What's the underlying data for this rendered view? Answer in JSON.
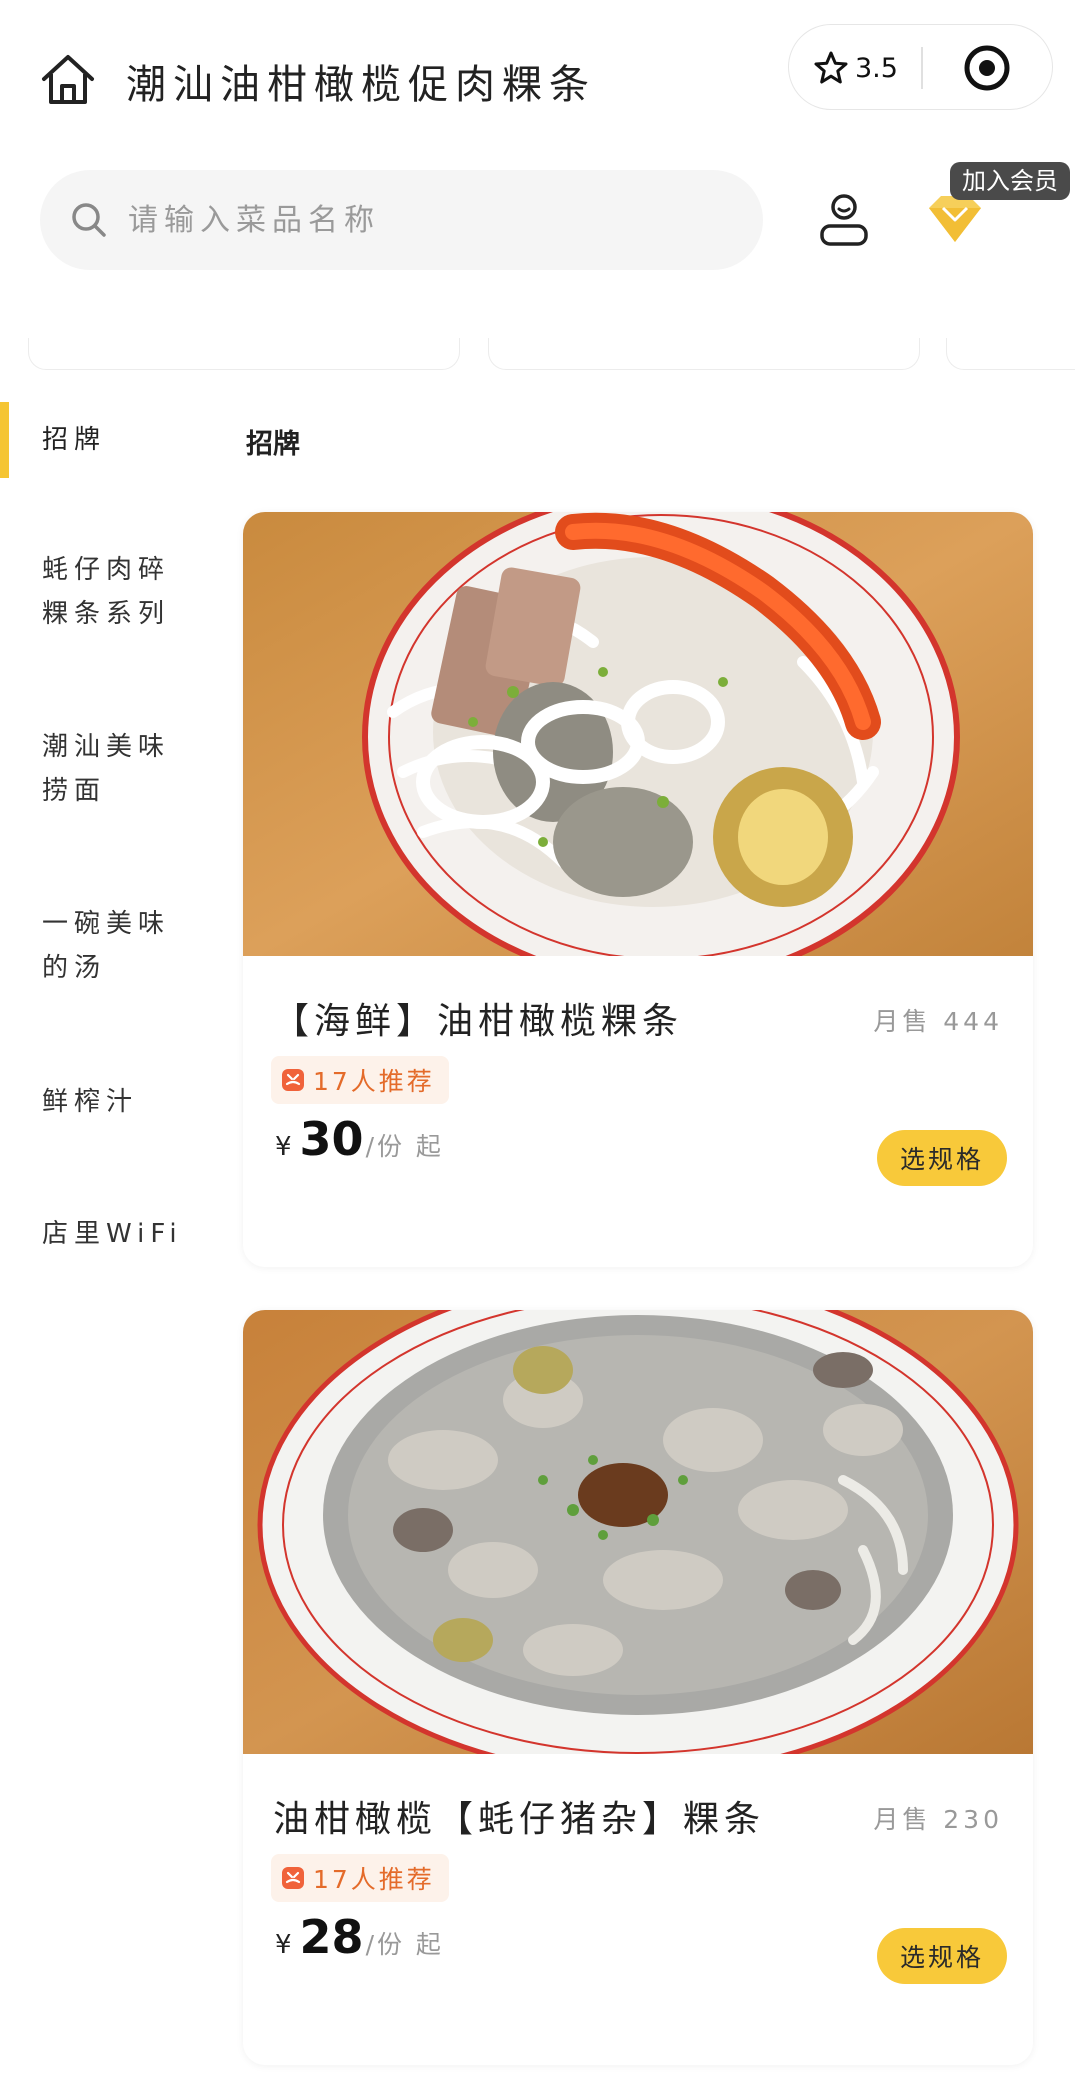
{
  "header": {
    "title": "潮汕油柑橄榄促肉粿条",
    "rating": "3.5",
    "search_placeholder": "请输入菜品名称",
    "vip_tip": "加入会员"
  },
  "sidebar": {
    "items": [
      {
        "label": "招牌",
        "active": true
      },
      {
        "label": "蚝仔肉碎粿条系列",
        "active": false
      },
      {
        "label": "潮汕美味捞面",
        "active": false
      },
      {
        "label": "一碗美味的汤",
        "active": false
      },
      {
        "label": "鲜榨汁",
        "active": false
      },
      {
        "label": "店里WiFi",
        "active": false
      }
    ]
  },
  "section": {
    "title": "招牌"
  },
  "products": [
    {
      "name": "【海鲜】油柑橄榄粿条",
      "sales": "月售 444",
      "badge": "17人推荐",
      "currency": "¥",
      "price": "30",
      "unit": "/份 起",
      "button": "选规格"
    },
    {
      "name": "油柑橄榄【蚝仔猪杂】粿条",
      "sales": "月售 230",
      "badge": "17人推荐",
      "currency": "¥",
      "price": "28",
      "unit": "/份 起",
      "button": "选规格"
    }
  ],
  "colors": {
    "accent": "#f8c93a",
    "active_bar": "#f5c533",
    "badge_text": "#e46b2a",
    "badge_bg": "#fdf2ea"
  },
  "icons": [
    "home-icon",
    "star-icon",
    "target-icon",
    "search-icon",
    "user-icon",
    "diamond-icon",
    "recommend-icon"
  ]
}
